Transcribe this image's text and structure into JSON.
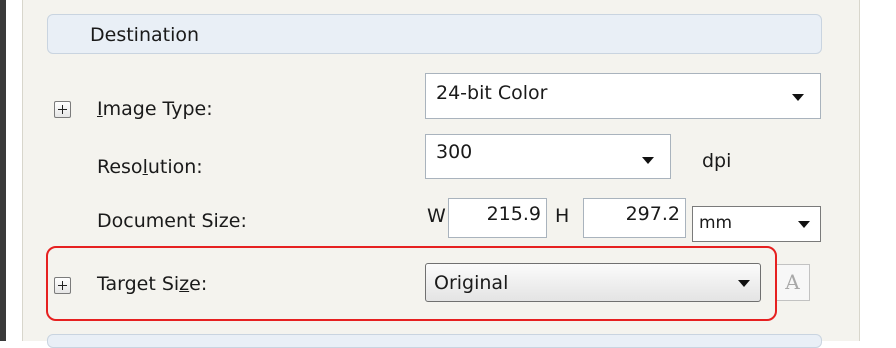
{
  "destination": {
    "header": "Destination"
  },
  "image_type": {
    "label_pre": "",
    "label_u": "I",
    "label_post": "mage Type:",
    "value": "24-bit Color"
  },
  "resolution": {
    "label_pre": "Reso",
    "label_u": "l",
    "label_post": "ution:",
    "value": "300",
    "unit": "dpi"
  },
  "document_size": {
    "label": "Document Size:",
    "w_label": "W",
    "width": "215.9",
    "h_label": "H",
    "height": "297.2",
    "unit": "mm"
  },
  "target_size": {
    "label_pre": "Target Si",
    "label_u": "z",
    "label_post": "e:",
    "value": "Original",
    "text_button": "A"
  }
}
